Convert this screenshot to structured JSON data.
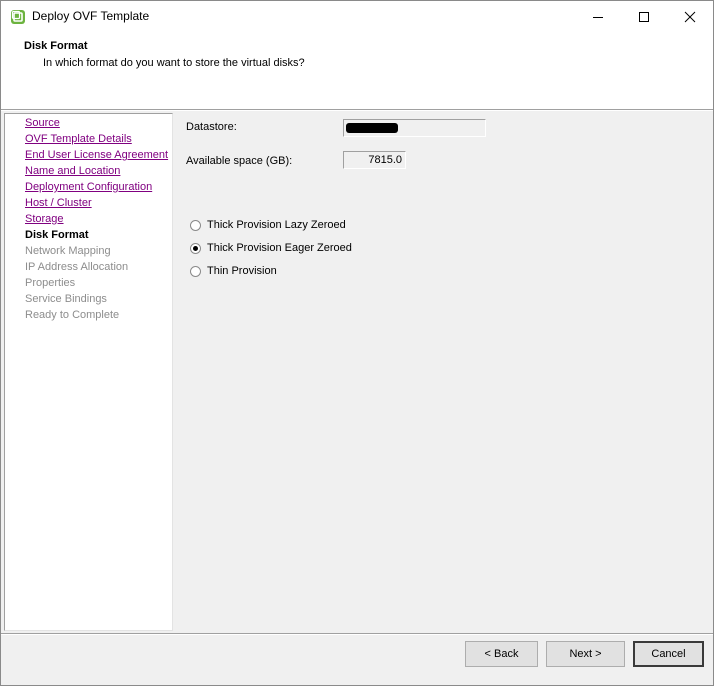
{
  "window": {
    "title": "Deploy OVF Template",
    "icon": "vmware-icon",
    "controls": [
      "minimize",
      "maximize",
      "close"
    ]
  },
  "header": {
    "title": "Disk Format",
    "subtitle": "In which format do you want to store the virtual disks?"
  },
  "sidebar": {
    "items": [
      {
        "label": "Source",
        "state": "done"
      },
      {
        "label": "OVF Template Details",
        "state": "done"
      },
      {
        "label": "End User License Agreement",
        "state": "done"
      },
      {
        "label": "Name and Location",
        "state": "done"
      },
      {
        "label": "Deployment Configuration",
        "state": "done"
      },
      {
        "label": "Host / Cluster",
        "state": "done"
      },
      {
        "label": "Storage",
        "state": "done"
      },
      {
        "label": "Disk Format",
        "state": "current"
      },
      {
        "label": "Network Mapping",
        "state": "pending"
      },
      {
        "label": "IP Address Allocation",
        "state": "pending"
      },
      {
        "label": "Properties",
        "state": "pending"
      },
      {
        "label": "Service Bindings",
        "state": "pending"
      },
      {
        "label": "Ready to Complete",
        "state": "pending"
      }
    ]
  },
  "main": {
    "datastore_label": "Datastore:",
    "available_label": "Available space (GB):",
    "available_value": "7815.0",
    "disk_options": [
      {
        "label": "Thick Provision Lazy Zeroed",
        "checked": false
      },
      {
        "label": "Thick Provision Eager Zeroed",
        "checked": true
      },
      {
        "label": "Thin Provision",
        "checked": false
      }
    ]
  },
  "footer": {
    "back_label": "< Back",
    "next_label": "Next >",
    "cancel_label": "Cancel"
  },
  "colors": {
    "link_visited": "#800080",
    "pending_text": "#8d8d8d",
    "dialog_bg": "#f0f0f0"
  }
}
